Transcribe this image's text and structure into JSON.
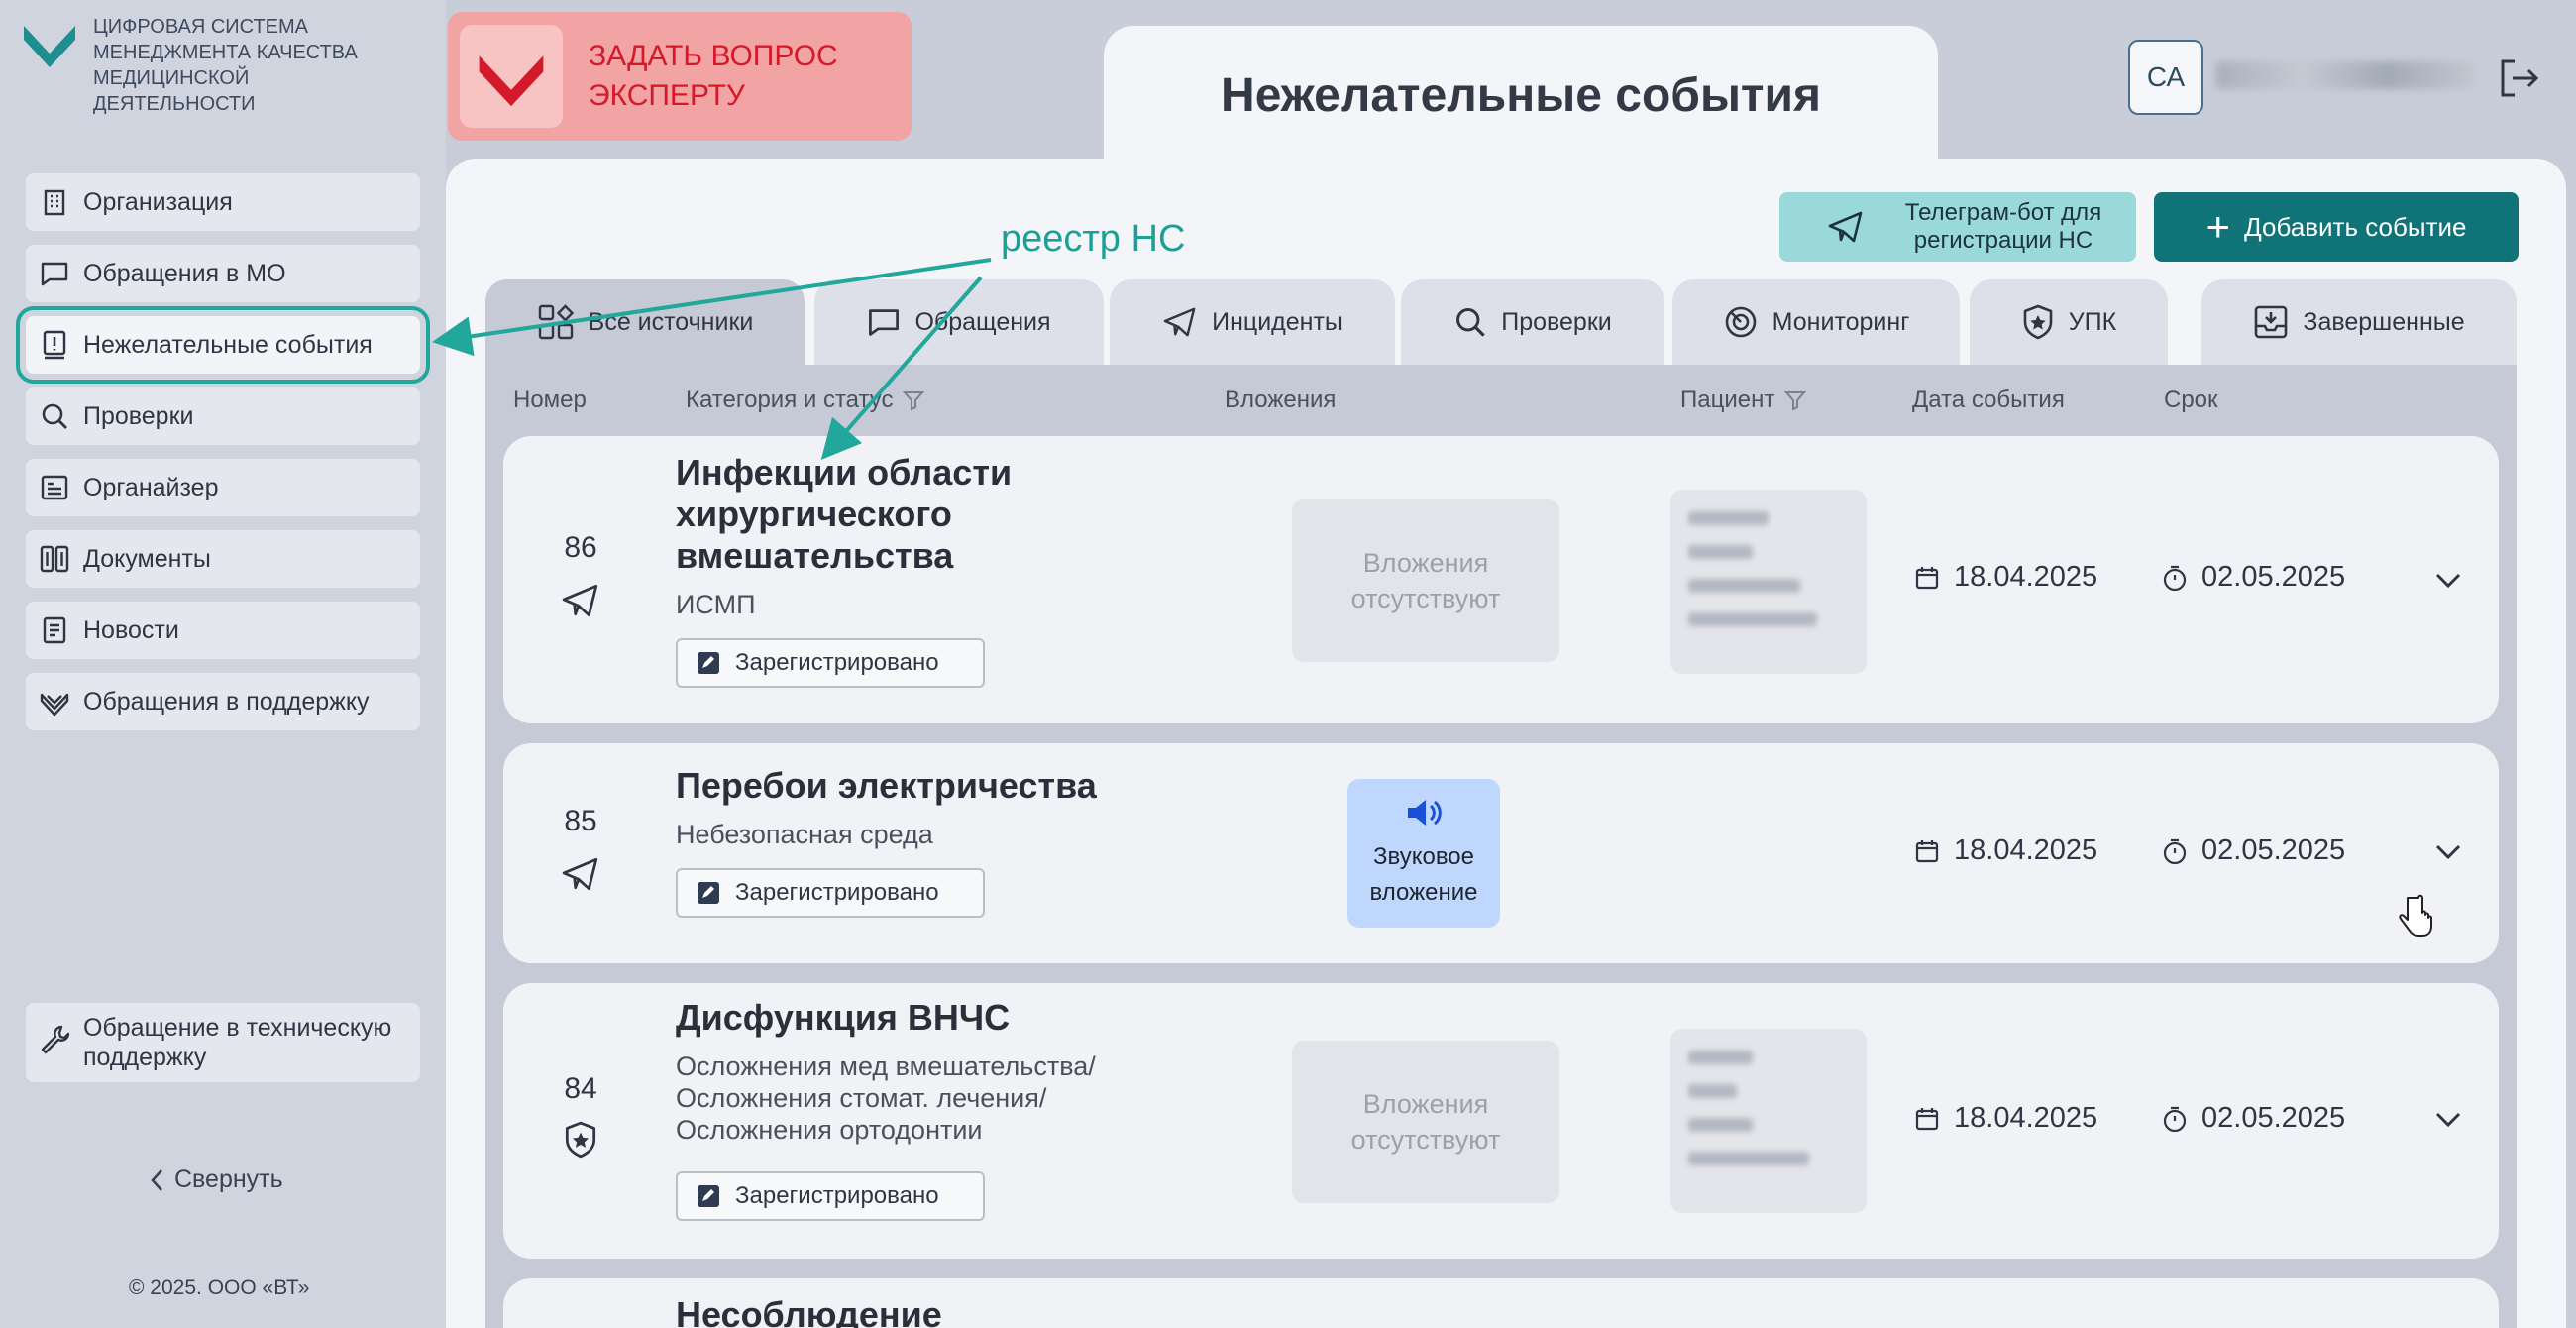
{
  "app": {
    "logo_text": "ЦИФРОВАЯ СИСТЕМА МЕНЕДЖМЕНТА КАЧЕСТВА МЕДИЦИНСКОЙ ДЕЯТЕЛЬНОСТИ",
    "page_title": "Нежелательные события",
    "expert_button": "ЗАДАТЬ ВОПРОС ЭКСПЕРТУ",
    "user_initials": "СА",
    "logout_icon": "logout-icon"
  },
  "sidebar": {
    "items": [
      {
        "label": "Организация",
        "icon": "building-icon"
      },
      {
        "label": "Обращения в МО",
        "icon": "message-icon"
      },
      {
        "label": "Нежелательные события",
        "icon": "alert-icon",
        "active": true
      },
      {
        "label": "Проверки",
        "icon": "search-icon"
      },
      {
        "label": "Органайзер",
        "icon": "organizer-icon"
      },
      {
        "label": "Документы",
        "icon": "documents-icon"
      },
      {
        "label": "Новости",
        "icon": "news-icon"
      },
      {
        "label": "Обращения в поддержку",
        "icon": "support-icon"
      }
    ],
    "tech_support": "Обращение в техническую поддержку",
    "collapse": "Свернуть",
    "copyright": "© 2025. ООО «ВТ»"
  },
  "toolbar": {
    "telegram_button": "Телеграм-бот для регистрации НС",
    "add_button": "Добавить событие"
  },
  "tabs": [
    {
      "label": "Все источники",
      "icon": "grid-icon",
      "active": true
    },
    {
      "label": "Обращения",
      "icon": "message-icon"
    },
    {
      "label": "Инциденты",
      "icon": "send-icon"
    },
    {
      "label": "Проверки",
      "icon": "search-icon"
    },
    {
      "label": "Мониторинг",
      "icon": "monitoring-icon"
    },
    {
      "label": "УПК",
      "icon": "shield-star-icon"
    },
    {
      "label": "Завершенные",
      "icon": "archive-icon"
    }
  ],
  "columns": {
    "number": "Номер",
    "category": "Категория и статус",
    "attachments": "Вложения",
    "patient": "Пациент",
    "event_date": "Дата события",
    "deadline": "Срок"
  },
  "rows": [
    {
      "number": "86",
      "source_icon": "send-icon",
      "title": "Инфекции области хирургического вмешательства",
      "subtitle": "ИСМП",
      "status": "Зарегистрировано",
      "attachment": "Вложения отсутствуют",
      "event_date": "18.04.2025",
      "deadline": "02.05.2025"
    },
    {
      "number": "85",
      "source_icon": "send-icon",
      "title": "Перебои электричества",
      "subtitle": "Небезопасная среда",
      "status": "Зарегистрировано",
      "attachment": "Звуковое вложение",
      "attachment_icon": "speaker-icon",
      "event_date": "18.04.2025",
      "deadline": "02.05.2025"
    },
    {
      "number": "84",
      "source_icon": "shield-star-icon",
      "title": "Дисфункция ВНЧС",
      "subtitle": "Осложнения мед вмешательства/ Осложнения стомат. лечения/ Осложнения ортодонтии",
      "status": "Зарегистрировано",
      "attachment": "Вложения отсутствуют",
      "event_date": "18.04.2025",
      "deadline": "02.05.2025"
    },
    {
      "title": "Несоблюдение"
    }
  ],
  "annotation": {
    "label": "реестр НС"
  },
  "colors": {
    "accent": "#0f7378",
    "annotation": "#21a79b",
    "expert_red": "#d4192b",
    "audio_bg": "#bfd7fd"
  }
}
